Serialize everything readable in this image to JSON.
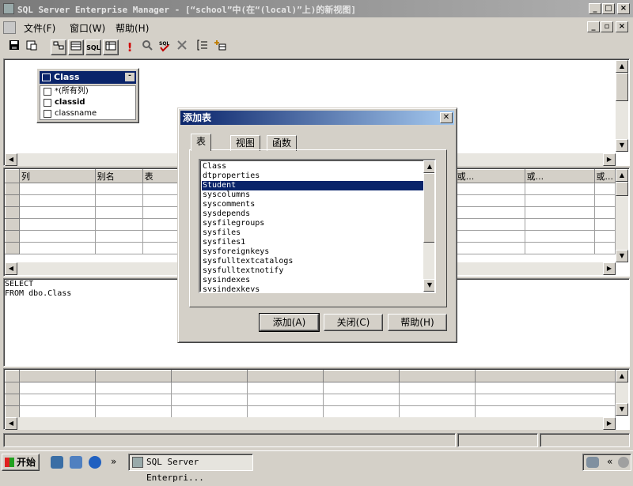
{
  "window": {
    "title": "SQL Server Enterprise Manager - [“school”中(在“(local)”上)的新视图]",
    "min": "_",
    "max": "□",
    "close": "×",
    "child_min": "_",
    "child_restore": "▫",
    "child_close": "×"
  },
  "menu": {
    "items": [
      "文件(F)",
      "窗口(W)",
      "帮助(H)"
    ]
  },
  "toolbar": {
    "buttons": [
      "save-icon",
      "properties-icon",
      "diagram-pane-icon",
      "grid-pane-icon",
      "sql-pane-icon",
      "results-pane-icon",
      "run-icon",
      "verify-sql-icon",
      "remove-filter-icon",
      "group-by-icon",
      "add-table-icon"
    ],
    "labels": {
      "sql": "SQL",
      "run": "!"
    }
  },
  "diagram": {
    "table": {
      "name": "Class",
      "columns": [
        "*(所有列)",
        "classid",
        "classname"
      ]
    }
  },
  "grid": {
    "headers": [
      "列",
      "别名",
      "表",
      "或...",
      "或...",
      "或..."
    ]
  },
  "sql": {
    "lines": [
      "SELECT",
      "FROM dbo.Class"
    ]
  },
  "dialog": {
    "title": "添加表",
    "tabs": [
      "表",
      "视图",
      "函数"
    ],
    "tables": [
      "Class",
      "dtproperties",
      "Student",
      "syscolumns",
      "syscomments",
      "sysdepends",
      "sysfilegroups",
      "sysfiles",
      "sysfiles1",
      "sysforeignkeys",
      "sysfulltextcatalogs",
      "sysfulltextnotify",
      "sysindexes",
      "sysindexkeys"
    ],
    "selected": "Student",
    "buttons": {
      "add": "添加(A)",
      "close": "关闭(C)",
      "help": "帮助(H)"
    }
  },
  "taskbar": {
    "start": "开始",
    "task": "SQL Server Enterpri...",
    "overflow": "»",
    "tray_overflow": "«"
  }
}
